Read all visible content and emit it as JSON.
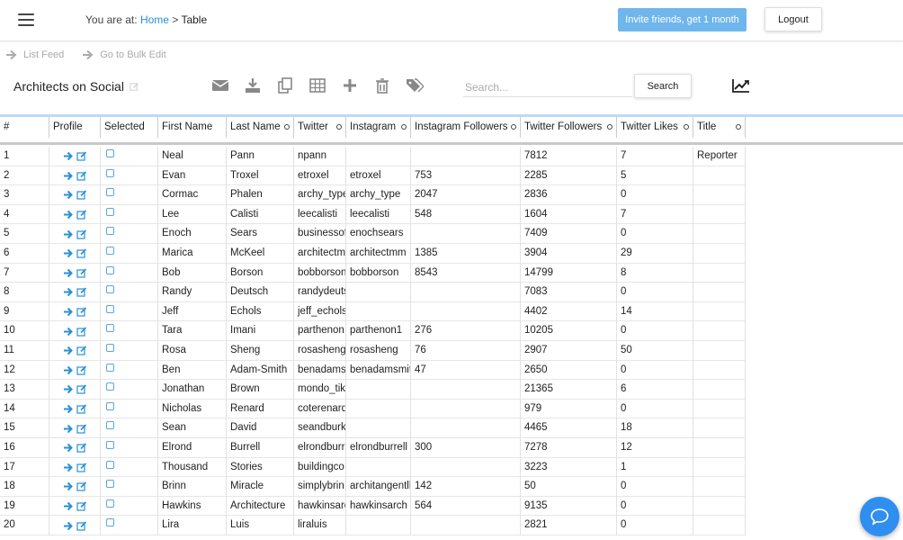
{
  "header": {
    "breadcrumb_prefix": "You are at:",
    "breadcrumb_home": "Home",
    "breadcrumb_sep": ">",
    "breadcrumb_current": "Table",
    "invite_label": "Invite friends, get 1 month",
    "logout_label": "Logout"
  },
  "actions": {
    "list_feed": "List Feed",
    "bulk_edit": "Go to Bulk Edit"
  },
  "page": {
    "title": "Architects on Social"
  },
  "search": {
    "placeholder": "Search...",
    "button_label": "Search"
  },
  "columns": [
    "#",
    "Profile",
    "Selected",
    "First Name",
    "Last Name",
    "Twitter",
    "Instagram",
    "Instagram Followers",
    "Twitter Followers",
    "Twitter Likes",
    "Title",
    ""
  ],
  "rows": [
    {
      "n": "1",
      "first": "Neal",
      "last": "Pann",
      "twitter": "npann",
      "instagram": "",
      "ig_followers": "",
      "tw_followers": "7812",
      "tw_likes": "7",
      "title": "Reporter"
    },
    {
      "n": "2",
      "first": "Evan",
      "last": "Troxel",
      "twitter": "etroxel",
      "instagram": "etroxel",
      "ig_followers": "753",
      "tw_followers": "2285",
      "tw_likes": "5",
      "title": ""
    },
    {
      "n": "3",
      "first": "Cormac",
      "last": "Phalen",
      "twitter": "archy_type",
      "instagram": "archy_type",
      "ig_followers": "2047",
      "tw_followers": "2836",
      "tw_likes": "0",
      "title": ""
    },
    {
      "n": "4",
      "first": "Lee",
      "last": "Calisti",
      "twitter": "leecalisti",
      "instagram": "leecalisti",
      "ig_followers": "548",
      "tw_followers": "1604",
      "tw_likes": "7",
      "title": ""
    },
    {
      "n": "5",
      "first": "Enoch",
      "last": "Sears",
      "twitter": "businessof",
      "instagram": "enochsears",
      "ig_followers": "",
      "tw_followers": "7409",
      "tw_likes": "0",
      "title": ""
    },
    {
      "n": "6",
      "first": "Marica",
      "last": "McKeel",
      "twitter": "architectm",
      "instagram": "architectmm",
      "ig_followers": "1385",
      "tw_followers": "3904",
      "tw_likes": "29",
      "title": ""
    },
    {
      "n": "7",
      "first": "Bob",
      "last": "Borson",
      "twitter": "bobborson",
      "instagram": "bobborson",
      "ig_followers": "8543",
      "tw_followers": "14799",
      "tw_likes": "8",
      "title": ""
    },
    {
      "n": "8",
      "first": "Randy",
      "last": "Deutsch",
      "twitter": "randydeuts",
      "instagram": "",
      "ig_followers": "",
      "tw_followers": "7083",
      "tw_likes": "0",
      "title": ""
    },
    {
      "n": "9",
      "first": "Jeff",
      "last": "Echols",
      "twitter": "jeff_echols",
      "instagram": "",
      "ig_followers": "",
      "tw_followers": "4402",
      "tw_likes": "14",
      "title": ""
    },
    {
      "n": "10",
      "first": "Tara",
      "last": "Imani",
      "twitter": "parthenon",
      "instagram": "parthenon1",
      "ig_followers": "276",
      "tw_followers": "10205",
      "tw_likes": "0",
      "title": ""
    },
    {
      "n": "11",
      "first": "Rosa",
      "last": "Sheng",
      "twitter": "rosasheng",
      "instagram": "rosasheng",
      "ig_followers": "76",
      "tw_followers": "2907",
      "tw_likes": "50",
      "title": ""
    },
    {
      "n": "12",
      "first": "Ben",
      "last": "Adam-Smith",
      "twitter": "benadams",
      "instagram": "benadamsmit",
      "ig_followers": "47",
      "tw_followers": "2650",
      "tw_likes": "0",
      "title": ""
    },
    {
      "n": "13",
      "first": "Jonathan",
      "last": "Brown",
      "twitter": "mondo_tik",
      "instagram": "",
      "ig_followers": "",
      "tw_followers": "21365",
      "tw_likes": "6",
      "title": ""
    },
    {
      "n": "14",
      "first": "Nicholas",
      "last": "Renard",
      "twitter": "coterenard",
      "instagram": "",
      "ig_followers": "",
      "tw_followers": "979",
      "tw_likes": "0",
      "title": ""
    },
    {
      "n": "15",
      "first": "Sean",
      "last": "David",
      "twitter": "seandburk",
      "instagram": "",
      "ig_followers": "",
      "tw_followers": "4465",
      "tw_likes": "18",
      "title": ""
    },
    {
      "n": "16",
      "first": "Elrond",
      "last": "Burrell",
      "twitter": "elrondburr",
      "instagram": "elrondburrell",
      "ig_followers": "300",
      "tw_followers": "7278",
      "tw_likes": "12",
      "title": ""
    },
    {
      "n": "17",
      "first": "Thousand",
      "last": "Stories",
      "twitter": "buildingco",
      "instagram": "",
      "ig_followers": "",
      "tw_followers": "3223",
      "tw_likes": "1",
      "title": ""
    },
    {
      "n": "18",
      "first": "Brinn",
      "last": "Miracle",
      "twitter": "simplybrin",
      "instagram": "architangentll",
      "ig_followers": "142",
      "tw_followers": "50",
      "tw_likes": "0",
      "title": ""
    },
    {
      "n": "19",
      "first": "Hawkins",
      "last": "Architecture",
      "twitter": "hawkinsarc",
      "instagram": "hawkinsarch",
      "ig_followers": "564",
      "tw_followers": "9135",
      "tw_likes": "0",
      "title": ""
    },
    {
      "n": "20",
      "first": "Lira",
      "last": "Luis",
      "twitter": "liraluis",
      "instagram": "",
      "ig_followers": "",
      "tw_followers": "2821",
      "tw_likes": "0",
      "title": ""
    }
  ],
  "toolbar_icons": [
    "envelope-icon",
    "download-icon",
    "copy-icon",
    "table-icon",
    "plus-icon",
    "trash-icon",
    "tags-icon"
  ],
  "colors": {
    "accent": "#2a8fd6",
    "invite_bg": "#6fb6ec",
    "chat_fab": "#2f8ff0",
    "header_rule": "#bcdaf2"
  }
}
